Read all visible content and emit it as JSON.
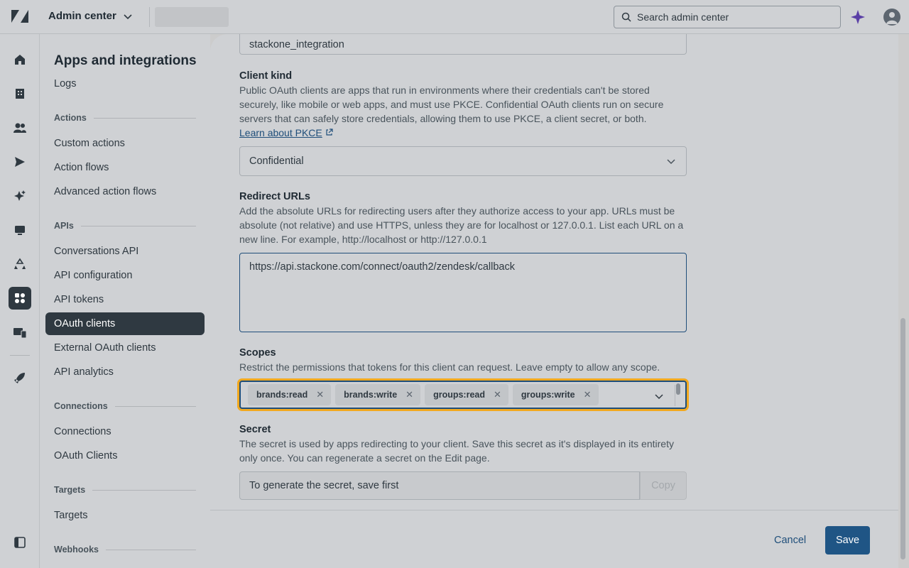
{
  "topbar": {
    "product_name": "Admin center",
    "search_placeholder": "Search admin center"
  },
  "subnav": {
    "title": "Apps and integrations",
    "logs": "Logs",
    "sections": {
      "actions": "Actions",
      "apis": "APIs",
      "connections": "Connections",
      "targets": "Targets",
      "webhooks": "Webhooks"
    },
    "items": {
      "custom_actions": "Custom actions",
      "action_flows": "Action flows",
      "advanced_action_flows": "Advanced action flows",
      "conversations_api": "Conversations API",
      "api_configuration": "API configuration",
      "api_tokens": "API tokens",
      "oauth_clients": "OAuth clients",
      "external_oauth_clients": "External OAuth clients",
      "api_analytics": "API analytics",
      "connections": "Connections",
      "oauth_clients_2": "OAuth Clients",
      "targets": "Targets"
    }
  },
  "form": {
    "identifier_value": "stackone_integration",
    "client_kind": {
      "label": "Client kind",
      "help": "Public OAuth clients are apps that run in environments where their credentials can't be stored securely, like mobile or web apps, and must use PKCE. Confidential OAuth clients run on secure servers that can safely store credentials, allowing them to use PKCE, a client secret, or both.",
      "link": "Learn about PKCE",
      "value": "Confidential"
    },
    "redirect_urls": {
      "label": "Redirect URLs",
      "help": "Add the absolute URLs for redirecting users after they authorize access to your app. URLs must be absolute (not relative) and use HTTPS, unless they are for localhost or 127.0.0.1. List each URL on a new line. For example, http://localhost or http://127.0.0.1",
      "value": "https://api.stackone.com/connect/oauth2/zendesk/callback"
    },
    "scopes": {
      "label": "Scopes",
      "help": "Restrict the permissions that tokens for this client can request. Leave empty to allow any scope.",
      "tags": [
        "brands:read",
        "brands:write",
        "groups:read",
        "groups:write"
      ]
    },
    "secret": {
      "label": "Secret",
      "help": "The secret is used by apps redirecting to your client. Save this secret as it's displayed in its entirety only once. You can regenerate a secret on the Edit page.",
      "value": "To generate the secret, save first",
      "copy_label": "Copy"
    }
  },
  "footer": {
    "cancel": "Cancel",
    "save": "Save"
  },
  "colors": {
    "accent": "#1f5585",
    "focus_ring": "#f2a91f",
    "nav_active": "#2f3941"
  }
}
